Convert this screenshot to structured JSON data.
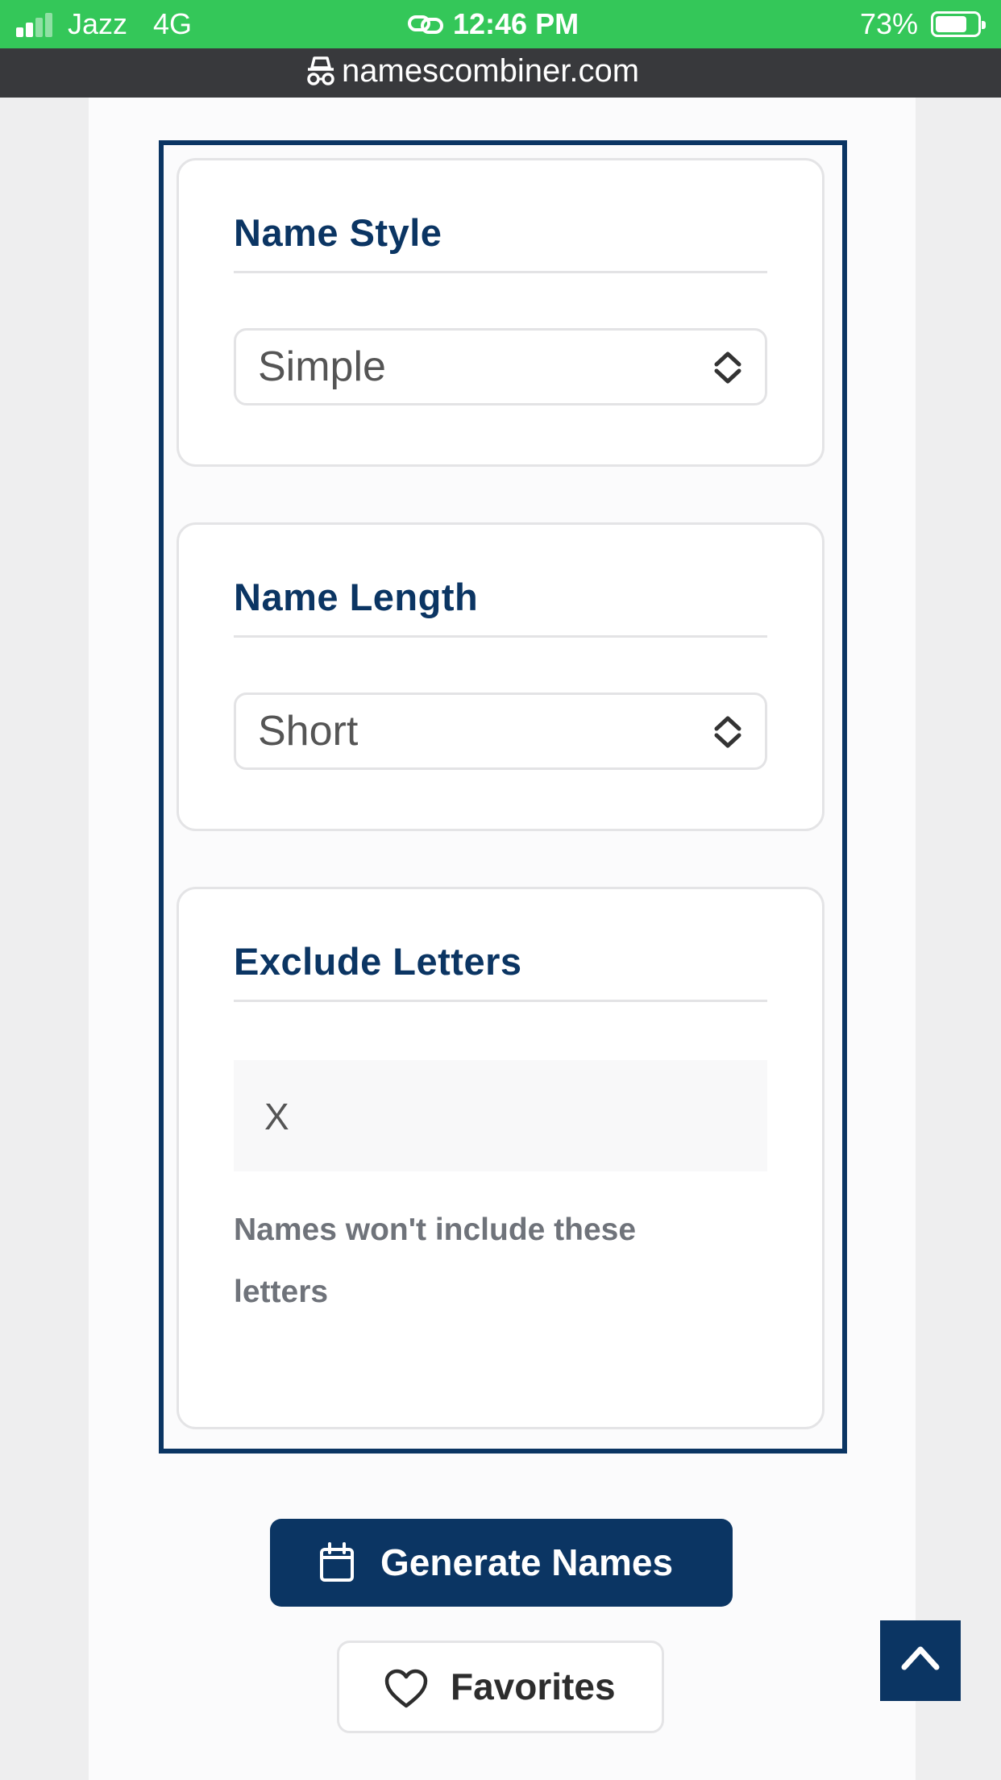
{
  "status_bar": {
    "carrier": "Jazz",
    "network": "4G",
    "time": "12:46 PM",
    "battery": "73%",
    "battery_level": 0.73,
    "signal_bars": 2
  },
  "url_bar": {
    "icon": "incognito-icon",
    "domain": "namescombiner.com"
  },
  "cards": {
    "name_style": {
      "title": "Name Style",
      "selected": "Simple"
    },
    "name_length": {
      "title": "Name Length",
      "selected": "Short"
    },
    "exclude_letters": {
      "title": "Exclude Letters",
      "value": "X",
      "help": "Names won't include these letters"
    }
  },
  "buttons": {
    "generate": "Generate Names",
    "favorites": "Favorites",
    "generate_icon": "calendar-icon",
    "favorites_icon": "heart-icon",
    "top_icon": "chevron-up-icon"
  },
  "colors": {
    "accent": "#0b3563",
    "status_bar": "#34c759"
  }
}
